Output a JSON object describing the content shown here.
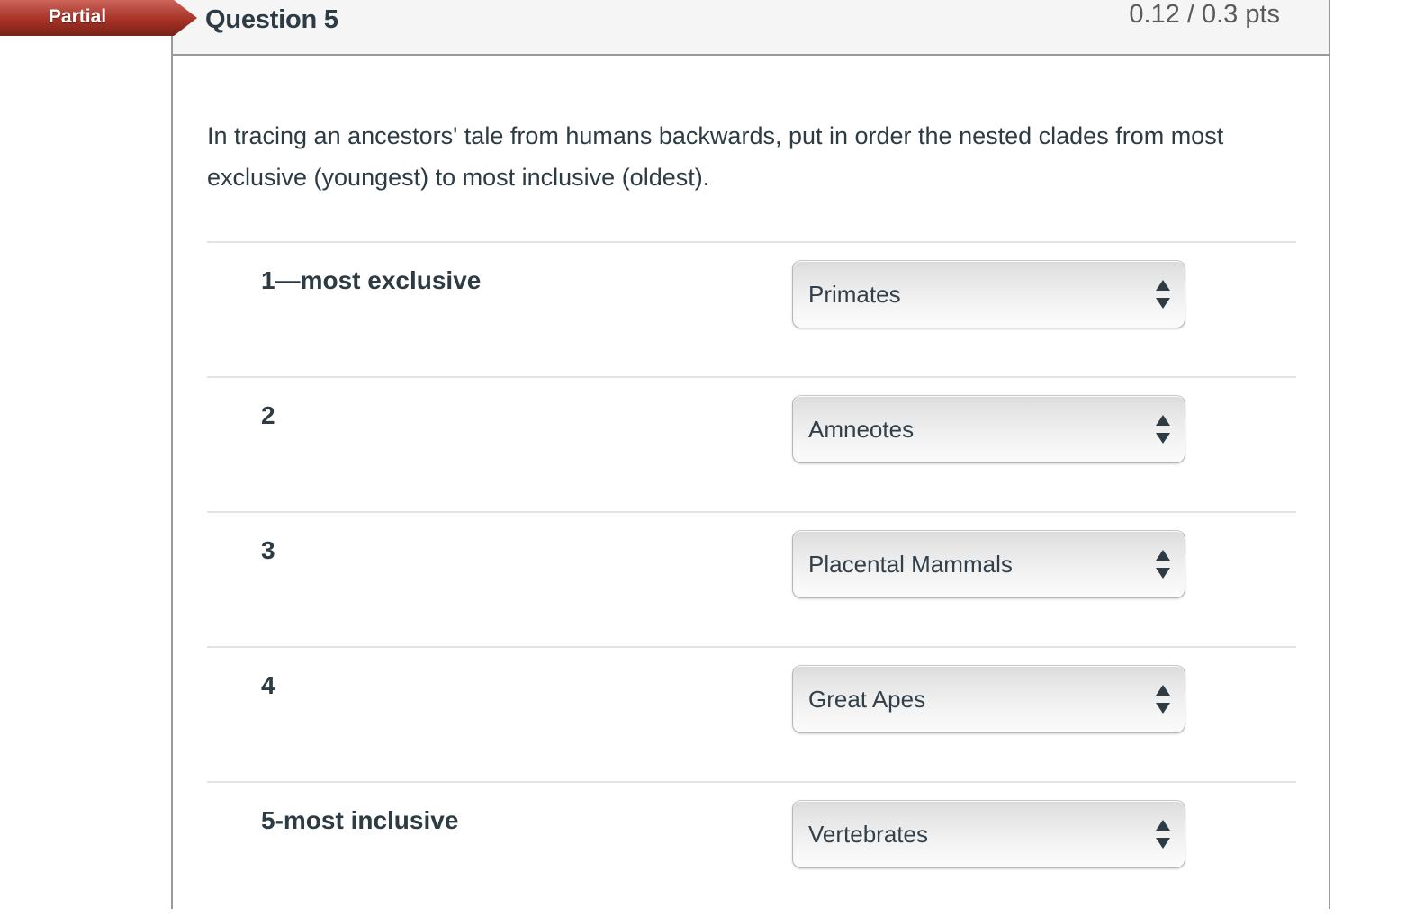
{
  "header": {
    "status_badge": "Partial",
    "question_name": "Question 5",
    "points": "0.12 / 0.3 pts",
    "badge_color": "#a83225",
    "header_bg": "#f5f5f5",
    "text_color": "#2d3b45"
  },
  "question": {
    "prompt": "In tracing an ancestors' tale from humans backwards, put in order the nested clades from most exclusive (youngest) to most inclusive (oldest)."
  },
  "answers": [
    {
      "label": "1—most exclusive",
      "selected": "Primates"
    },
    {
      "label": "2",
      "selected": "Amneotes"
    },
    {
      "label": "3",
      "selected": "Placental Mammals"
    },
    {
      "label": "4",
      "selected": "Great Apes"
    },
    {
      "label": "5-most inclusive",
      "selected": "Vertebrates"
    }
  ],
  "icons": {
    "sort_arrows": "up-down-arrows-icon"
  }
}
